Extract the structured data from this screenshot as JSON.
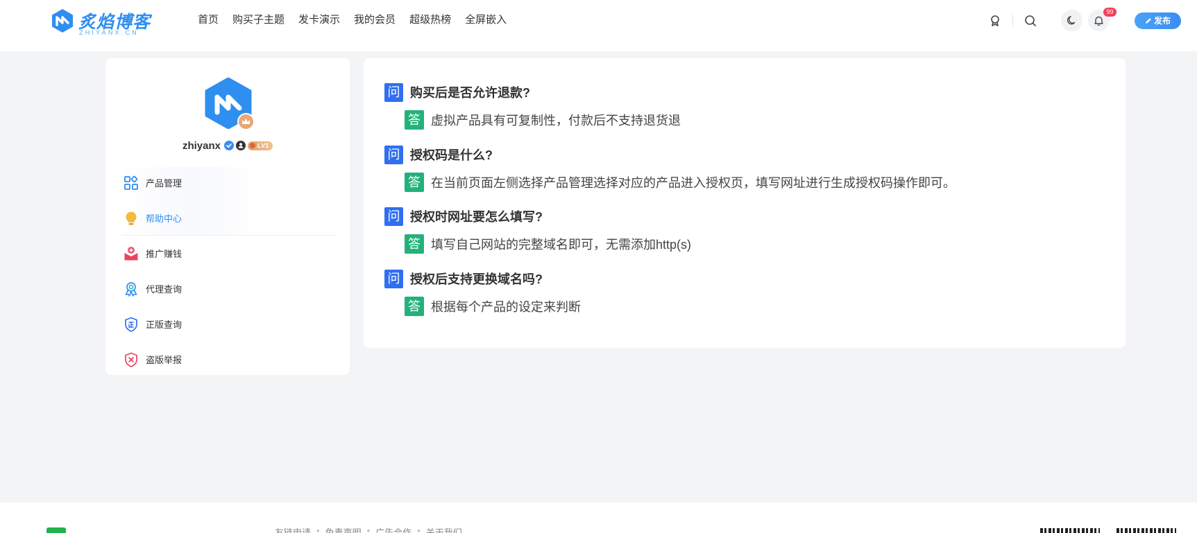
{
  "brand": {
    "name": "炙焰博客",
    "sub": "ZHIYANX.CN",
    "accent": "#2f8ff0"
  },
  "nav": {
    "items": [
      "首页",
      "购买子主题",
      "发卡演示",
      "我的会员",
      "超级热榜",
      "全屏嵌入"
    ]
  },
  "header": {
    "notification_count": "99",
    "publish_label": "发布",
    "icons": [
      "badge-icon",
      "search-icon",
      "moon-icon",
      "bell-icon"
    ]
  },
  "user": {
    "name": "zhiyanx",
    "level": "LV1"
  },
  "menu": {
    "items": [
      {
        "label": "产品管理",
        "icon": "grid-icon"
      },
      {
        "label": "帮助中心",
        "icon": "lightbulb-icon",
        "active": true
      },
      {
        "label": "推广赚钱",
        "icon": "envelope-icon"
      },
      {
        "label": "代理查询",
        "icon": "award-icon"
      },
      {
        "label": "正版查询",
        "icon": "genuine-shield-icon"
      },
      {
        "label": "盗版举报",
        "icon": "report-shield-icon"
      }
    ]
  },
  "faq": {
    "q_tag": "问",
    "a_tag": "答",
    "items": [
      {
        "q": "购买后是否允许退款?",
        "a": "虚拟产品具有可复制性，付款后不支持退货退"
      },
      {
        "q": "授权码是什么?",
        "a": "在当前页面左侧选择产品管理选择对应的产品进入授权页，填写网址进行生成授权码操作即可。"
      },
      {
        "q": "授权时网址要怎么填写?",
        "a": "填写自己网站的完整域名即可，无需添加http(s)"
      },
      {
        "q": "授权后支持更换域名吗?",
        "a": "根据每个产品的设定来判断"
      }
    ]
  },
  "footer": {
    "links": [
      "友链申请",
      "免责声明",
      "广告合作",
      "关于我们"
    ]
  }
}
